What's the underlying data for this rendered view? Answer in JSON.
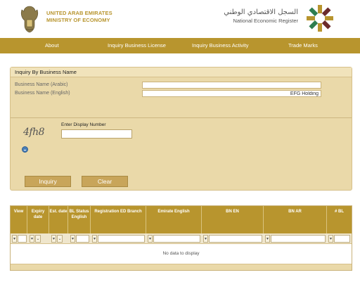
{
  "header": {
    "ministry_line1": "UNITED ARAB EMIRATES",
    "ministry_line2": "MINISTRY OF ECONOMY",
    "register_ar": "السجل الاقتصادي الوطني",
    "register_en": "National Economic Register"
  },
  "nav": {
    "items": [
      "About",
      "Inquiry Business License",
      "Inquiry Business Activity",
      "Trade Marks"
    ]
  },
  "form": {
    "title": "Inquiry By Business Name",
    "name_ar_label": "Business Name (Arabic)",
    "name_ar_value": "",
    "name_en_label": "Business Name (English)",
    "name_en_value": "EFG Holding",
    "captcha_label": "Enter Display Number",
    "captcha_text": "4fh8",
    "inquiry_label": "Inquiry",
    "clear_label": "Clear"
  },
  "grid": {
    "columns": [
      "View",
      "Expiry date",
      "Est. date",
      "BL Status English",
      "Registration ED Branch",
      "Emirate English",
      "BN EN",
      "BN AR",
      "# BL"
    ],
    "empty_text": "No data to display"
  },
  "colors": {
    "brand_gold": "#b8952e",
    "panel_bg": "#ead9a9"
  },
  "icons": [
    "uae-emblem-icon",
    "ner-logo-icon",
    "refresh-icon",
    "filter-icon",
    "dropdown-icon"
  ]
}
